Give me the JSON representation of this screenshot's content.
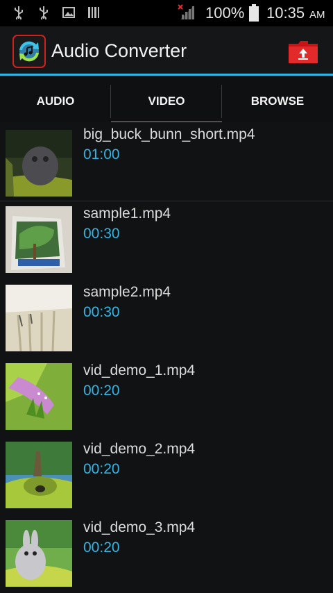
{
  "status_bar": {
    "icons": [
      "usb-icon",
      "usb-icon",
      "image-icon",
      "barcode-icon",
      "no-signal-icon"
    ],
    "battery_percent": "100%",
    "time": "10:35",
    "ampm": "AM"
  },
  "app_bar": {
    "title": "Audio Converter",
    "logo_icon": "audio-converter-logo-icon",
    "action_icon": "red-folder-upload-icon"
  },
  "tabs": [
    {
      "label": "AUDIO",
      "selected": false
    },
    {
      "label": "VIDEO",
      "selected": true
    },
    {
      "label": "BROWSE",
      "selected": false
    }
  ],
  "colors": {
    "accent": "#33b5e5",
    "background": "#101214"
  },
  "videos": [
    {
      "name": "big_buck_bunn_short.mp4",
      "duration": "01:00"
    },
    {
      "name": "sample1.mp4",
      "duration": "00:30"
    },
    {
      "name": "sample2.mp4",
      "duration": "00:30"
    },
    {
      "name": "vid_demo_1.mp4",
      "duration": "00:20"
    },
    {
      "name": "vid_demo_2.mp4",
      "duration": "00:20"
    },
    {
      "name": "vid_demo_3.mp4",
      "duration": "00:20"
    }
  ]
}
